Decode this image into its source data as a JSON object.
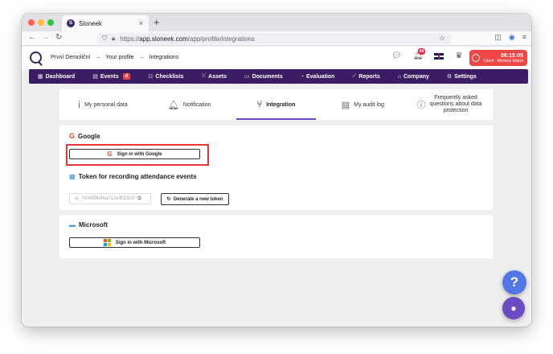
{
  "browser": {
    "tab_title": "Sloneek",
    "tab_close": "×",
    "new_tab": "+",
    "url_prefix": "https://",
    "url_host": "app.sloneek.com",
    "url_path": "/app/profile/integrations"
  },
  "header": {
    "breadcrumbs": [
      "První Demoliční",
      "→",
      "Your profile",
      "→",
      "Integrations"
    ],
    "notification_count": "44",
    "clock_time": "06:15:05",
    "clock_location": "Client - Monkey Island"
  },
  "mainnav": {
    "items": [
      {
        "icon": "▦",
        "label": "Dashboard"
      },
      {
        "icon": "▤",
        "label": "Events",
        "count": "4"
      },
      {
        "icon": "☷",
        "label": "Checklists"
      },
      {
        "icon": "⤫",
        "label": "Assets"
      },
      {
        "icon": "▭",
        "label": "Documents"
      },
      {
        "icon": "◔",
        "label": "Evaluation"
      },
      {
        "icon": "⟋",
        "label": "Reports"
      },
      {
        "icon": "⌂",
        "label": "Company"
      },
      {
        "icon": "⚙",
        "label": "Settings"
      }
    ]
  },
  "subtabs": {
    "personal": "My personal data",
    "notification": "Notification",
    "integration": "Integration",
    "audit": "My audit log",
    "faq_line1": "Frequently asked",
    "faq_line2": "questions about data",
    "faq_line3": "protection"
  },
  "google": {
    "title": "Google",
    "signin": "Sign in with Google",
    "token_title": "Token for recording attendance events",
    "token_value": "ai_743489b46a712e9f1f3c9",
    "generate": "Generate a new token"
  },
  "microsoft": {
    "title": "Microsoft",
    "signin": "Sign in with Microsoft"
  },
  "fab": {
    "help": "?",
    "chat": "●"
  },
  "colors": {
    "nav_bg": "#3a1d63",
    "accent": "#6b4bc4",
    "alert": "#ef4646",
    "highlight": "#e53935"
  }
}
